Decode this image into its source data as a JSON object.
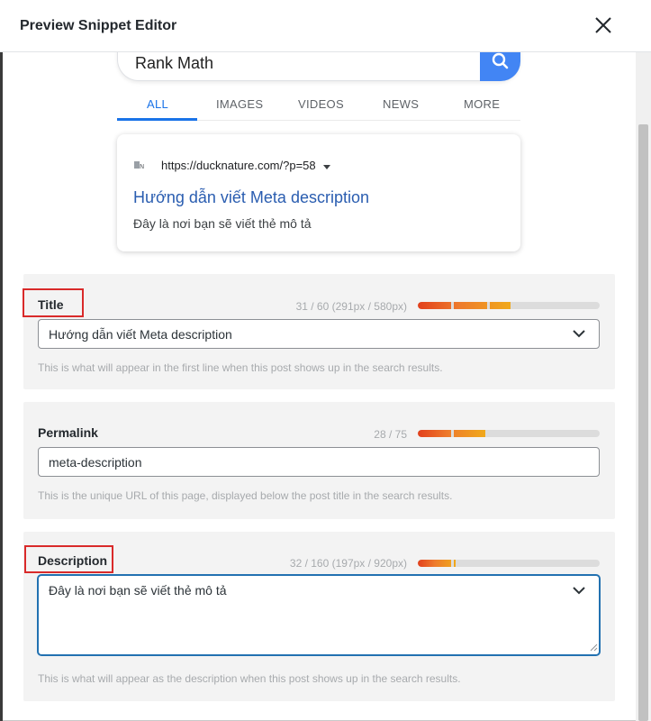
{
  "dialog": {
    "title": "Preview Snippet Editor"
  },
  "google_preview": {
    "search_query": "Rank Math",
    "tabs": [
      {
        "label": "ALL",
        "active": true
      },
      {
        "label": "IMAGES",
        "active": false
      },
      {
        "label": "VIDEOS",
        "active": false
      },
      {
        "label": "NEWS",
        "active": false
      },
      {
        "label": "MORE",
        "active": false
      }
    ],
    "result": {
      "url": "https://ducknature.com/?p=58",
      "title": "Hướng dẫn viết Meta description",
      "description": "Đây là nơi bạn sẽ viết thẻ mô tả"
    }
  },
  "fields": {
    "title": {
      "label": "Title",
      "counter": "31 / 60 (291px / 580px)",
      "progress": 0.51,
      "value": "Hướng dẫn viết Meta description",
      "help": "This is what will appear in the first line when this post shows up in the search results."
    },
    "permalink": {
      "label": "Permalink",
      "counter": "28 / 75",
      "progress": 0.37,
      "value": "meta-description",
      "help": "This is the unique URL of this page, displayed below the post title in the search results."
    },
    "description": {
      "label": "Description",
      "counter": "32 / 160 (197px / 920px)",
      "progress": 0.21,
      "value": "Đây là nơi bạn sẽ viết thẻ mô tả",
      "help": "This is what will appear as the description when this post shows up in the search results."
    }
  },
  "colors": {
    "accent": "#2271b1",
    "google_blue": "#4285f4",
    "highlight_box": "#d92a2a",
    "meter_start": "#e2401c",
    "meter_end": "#f0a91a"
  }
}
